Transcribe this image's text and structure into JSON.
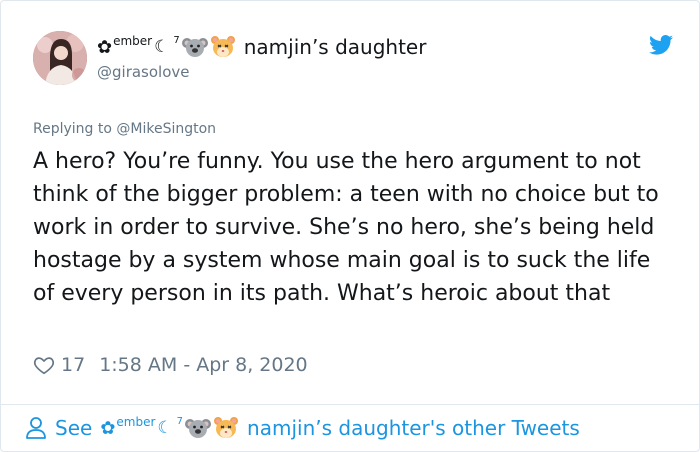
{
  "tweet": {
    "display_name_decor": {
      "flower": "✿",
      "sup": "ember",
      "moon": "☾",
      "num": "7"
    },
    "display_name": "namjin’s daughter",
    "handle": "@girasolove",
    "reply_to": "Replying to @MikeSington",
    "text": "A hero? You’re funny. You use the hero argument to not think of the bigger problem: a teen with no choice but to work in order to survive. She’s no hero, she’s being held hostage by a system whose main goal is to suck the life of every person in its path. What’s heroic about that",
    "likes": "17",
    "timestamp": "1:58 AM - Apr 8, 2020"
  },
  "footer": {
    "see": "See",
    "other_tweets": "namjin’s daughter's other Tweets"
  },
  "colors": {
    "text": "#14171a",
    "muted": "#657786",
    "link": "#1b95e0",
    "twitter_blue": "#1da1f2"
  },
  "icons": [
    "avatar-photo",
    "koala-emoji",
    "hamster-emoji",
    "twitter-bird-icon",
    "heart-icon",
    "person-icon"
  ]
}
